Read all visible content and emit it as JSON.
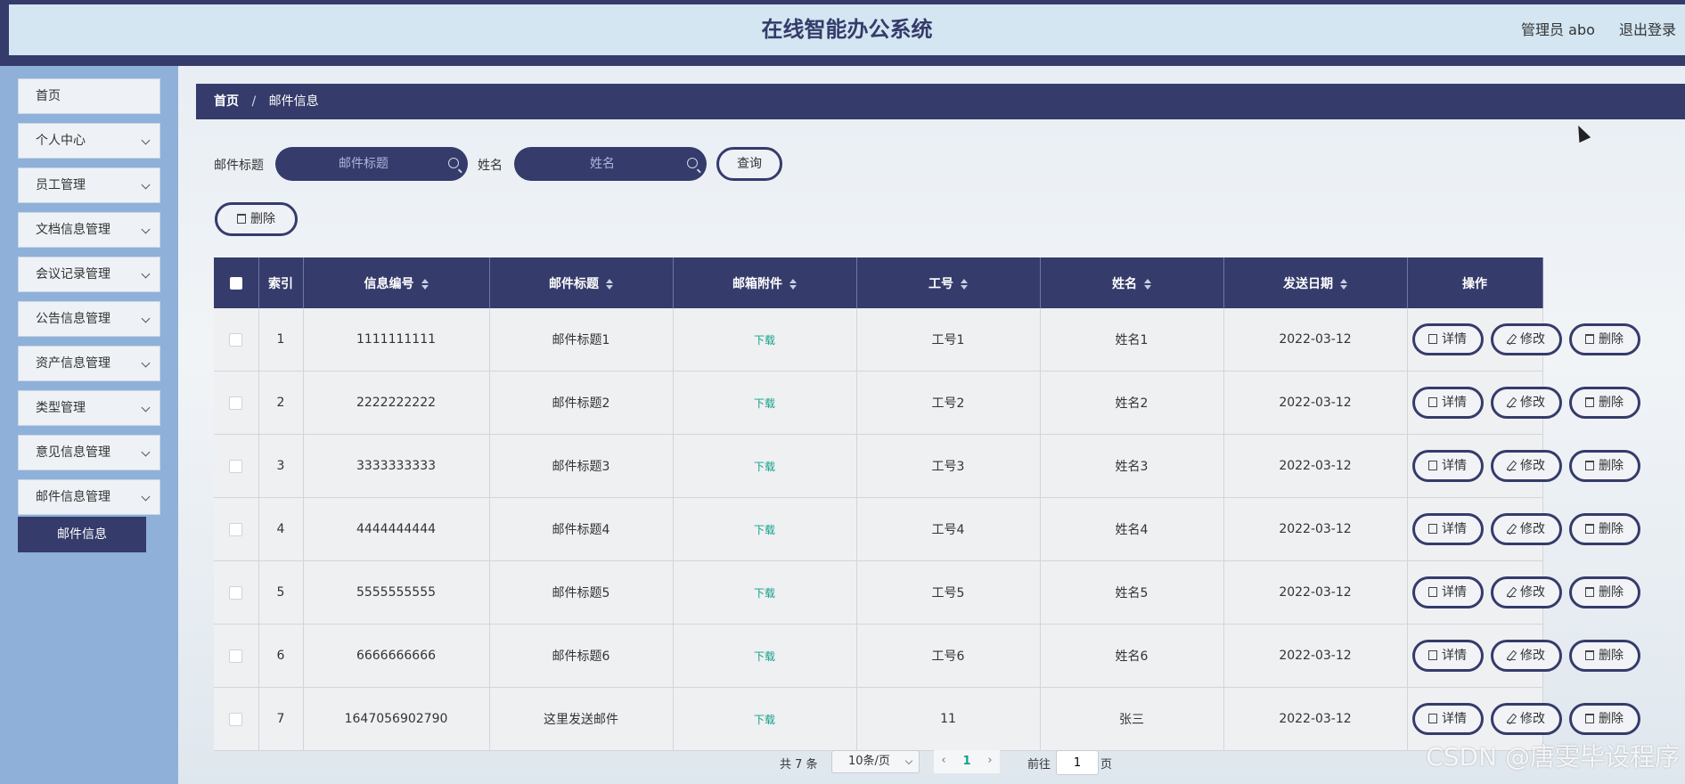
{
  "header": {
    "title": "在线智能办公系统",
    "user": "管理员 abo",
    "logout": "退出登录"
  },
  "sidebar": {
    "items": [
      {
        "label": "首页"
      },
      {
        "label": "个人中心"
      },
      {
        "label": "员工管理"
      },
      {
        "label": "文档信息管理"
      },
      {
        "label": "会议记录管理"
      },
      {
        "label": "公告信息管理"
      },
      {
        "label": "资产信息管理"
      },
      {
        "label": "类型管理"
      },
      {
        "label": "意见信息管理"
      },
      {
        "label": "邮件信息管理"
      }
    ],
    "sub_item": "邮件信息"
  },
  "breadcrumb": {
    "home": "首页",
    "sep": "/",
    "current": "邮件信息"
  },
  "search": {
    "title_label": "邮件标题",
    "title_placeholder": "邮件标题",
    "name_label": "姓名",
    "name_placeholder": "姓名",
    "query_button": "查询"
  },
  "toolbar": {
    "delete_button": "删除"
  },
  "table": {
    "headers": [
      "索引",
      "信息编号",
      "邮件标题",
      "邮箱附件",
      "工号",
      "姓名",
      "发送日期",
      "操作"
    ],
    "download_label": "下载",
    "actions": {
      "detail": "详情",
      "edit": "修改",
      "delete": "删除"
    },
    "rows": [
      {
        "index": "1",
        "code": "1111111111",
        "title": "邮件标题1",
        "job_no": "工号1",
        "name": "姓名1",
        "date": "2022-03-12"
      },
      {
        "index": "2",
        "code": "2222222222",
        "title": "邮件标题2",
        "job_no": "工号2",
        "name": "姓名2",
        "date": "2022-03-12"
      },
      {
        "index": "3",
        "code": "3333333333",
        "title": "邮件标题3",
        "job_no": "工号3",
        "name": "姓名3",
        "date": "2022-03-12"
      },
      {
        "index": "4",
        "code": "4444444444",
        "title": "邮件标题4",
        "job_no": "工号4",
        "name": "姓名4",
        "date": "2022-03-12"
      },
      {
        "index": "5",
        "code": "5555555555",
        "title": "邮件标题5",
        "job_no": "工号5",
        "name": "姓名5",
        "date": "2022-03-12"
      },
      {
        "index": "6",
        "code": "6666666666",
        "title": "邮件标题6",
        "job_no": "工号6",
        "name": "姓名6",
        "date": "2022-03-12"
      },
      {
        "index": "7",
        "code": "1647056902790",
        "title": "这里发送邮件",
        "job_no": "11",
        "name": "张三",
        "date": "2022-03-12"
      }
    ]
  },
  "pagination": {
    "total": "共 7 条",
    "page_size": "10条/页",
    "prev": "‹",
    "current": "1",
    "next": "›",
    "goto_label": "前往",
    "goto_value": "1",
    "page_label": "页"
  },
  "watermark": "CSDN @唐雯毕设程序"
}
